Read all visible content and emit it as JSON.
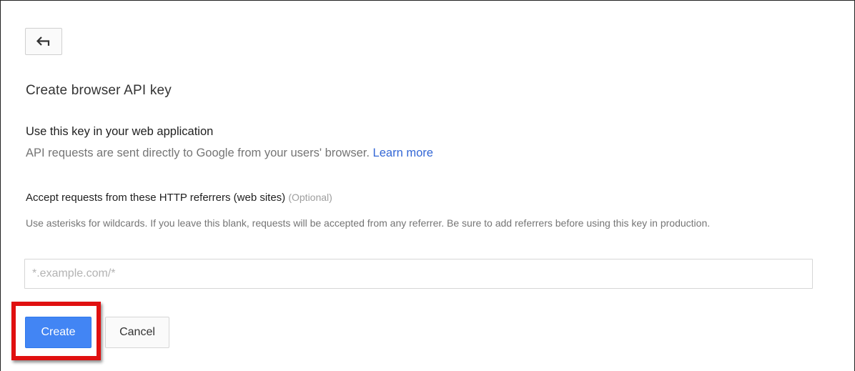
{
  "icons": {
    "back": "back-arrow-icon"
  },
  "page": {
    "title": "Create browser API key"
  },
  "usage": {
    "heading": "Use this key in your web application",
    "description": "API requests are sent directly to Google from your users' browser.",
    "learn_more": "Learn more"
  },
  "referrers": {
    "label": "Accept requests from these HTTP referrers (web sites)",
    "optional": "(Optional)",
    "help": "Use asterisks for wildcards. If you leave this blank, requests will be accepted from any referrer. Be sure to add referrers before using this key in production.",
    "placeholder": "*.example.com/*",
    "value": ""
  },
  "actions": {
    "create_label": "Create",
    "cancel_label": "Cancel"
  },
  "colors": {
    "primary": "#4285f4",
    "link": "#3367d6",
    "highlight": "#e01010"
  }
}
